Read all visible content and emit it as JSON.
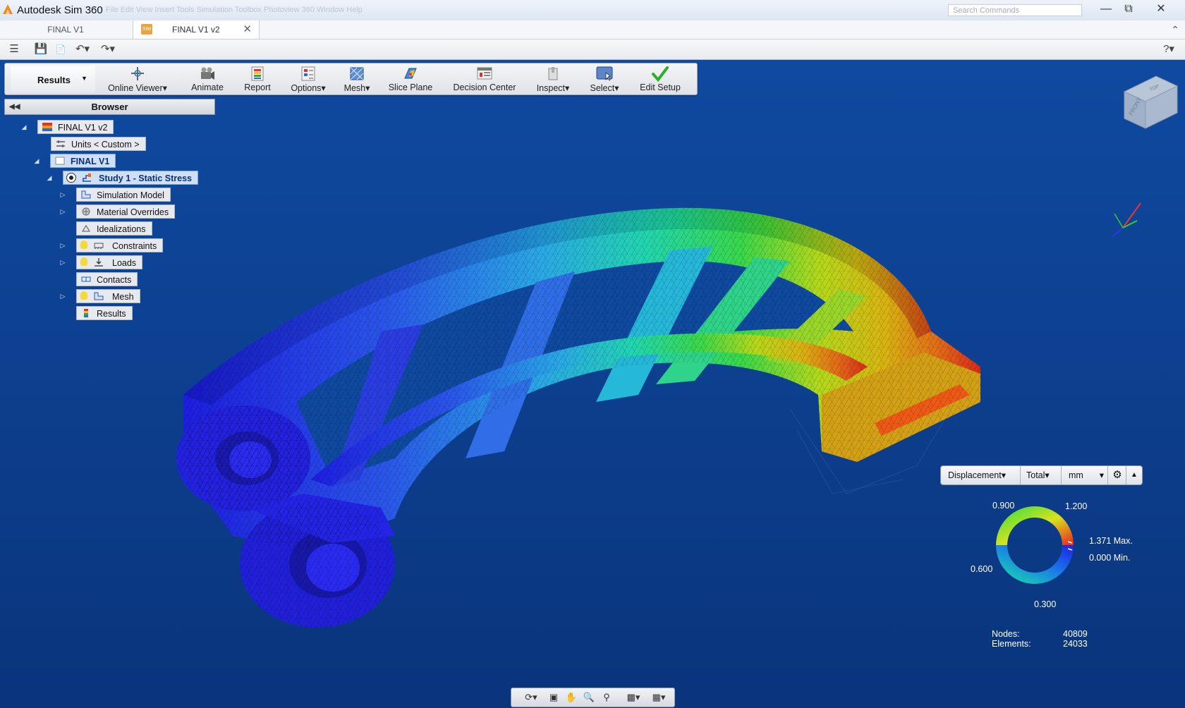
{
  "window": {
    "app_title": "Autodesk Sim 360",
    "menu_ghost": "File   Edit   View   Insert   Tools   Simulation   Toolbox   Photoview 360   Window   Help",
    "search_placeholder": "Search Commands",
    "minimize_icon": "minimize-icon",
    "restore_icon": "restore-icon",
    "close_icon": "close-icon"
  },
  "tabs": [
    {
      "label": "FINAL V1",
      "active": false
    },
    {
      "label": "FINAL V1 v2",
      "active": true
    }
  ],
  "toolbar": {
    "results_label": "Results",
    "buttons": [
      {
        "label": "Online Viewer",
        "has_menu": true,
        "icon": "online-viewer-icon"
      },
      {
        "label": "Animate",
        "has_menu": false,
        "icon": "animate-icon"
      },
      {
        "label": "Report",
        "has_menu": false,
        "icon": "report-icon"
      },
      {
        "label": "Options",
        "has_menu": true,
        "icon": "options-icon"
      },
      {
        "label": "Mesh",
        "has_menu": true,
        "icon": "mesh-icon"
      },
      {
        "label": "Slice Plane",
        "has_menu": false,
        "icon": "slice-plane-icon"
      },
      {
        "label": "Decision Center",
        "has_menu": false,
        "icon": "decision-center-icon"
      },
      {
        "label": "Inspect",
        "has_menu": true,
        "icon": "inspect-icon"
      },
      {
        "label": "Select",
        "has_menu": true,
        "icon": "select-icon"
      },
      {
        "label": "Edit Setup",
        "has_menu": false,
        "icon": "edit-setup-icon"
      }
    ]
  },
  "browser": {
    "title": "Browser",
    "nodes": [
      {
        "label": "FINAL V1 v2"
      },
      {
        "label": "Units < Custom >"
      },
      {
        "label": "FINAL V1"
      },
      {
        "label": "Study 1 - Static Stress"
      },
      {
        "label": "Simulation Model"
      },
      {
        "label": "Material Overrides"
      },
      {
        "label": "Idealizations"
      },
      {
        "label": "Constraints"
      },
      {
        "label": "Loads"
      },
      {
        "label": "Contacts"
      },
      {
        "label": "Mesh"
      },
      {
        "label": "Results"
      }
    ]
  },
  "legend": {
    "result_type": "Displacement",
    "component": "Total",
    "units": "mm",
    "labels": {
      "l900": "0.900",
      "l1200": "1.200",
      "max": "1.371 Max.",
      "min": "0.000 Min.",
      "l600": "0.600",
      "l300": "0.300"
    }
  },
  "stats": {
    "nodes_label": "Nodes:",
    "nodes_value": "40809",
    "elements_label": "Elements:",
    "elements_value": "24033"
  },
  "viewcube": {
    "face_front": "FRONT",
    "face_top": "TOP"
  }
}
